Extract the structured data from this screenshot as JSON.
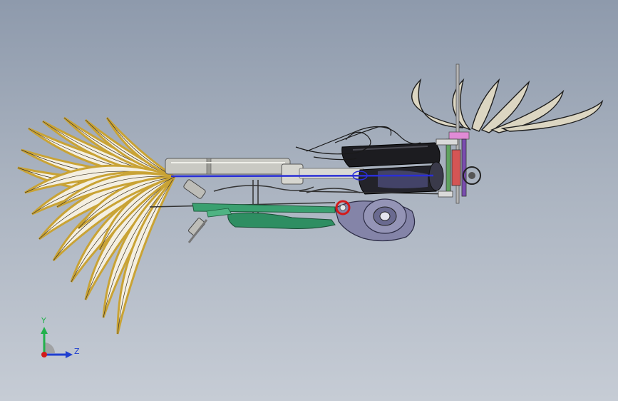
{
  "viewport": {
    "background_top": "#8e9aac",
    "background_bottom": "#c6ccd5"
  },
  "triad": {
    "y_label": "Y",
    "z_label": "Z",
    "y_color": "#22b14c",
    "z_color": "#1f3fd0",
    "x_color": "#d11a1a"
  },
  "model": {
    "description_icon": "assembly-model-icon",
    "feather_color": "#c9a335",
    "feather_fill": "#f4efe1",
    "body_black": "#1b1b1f",
    "tube_grey": "#c8c8c2",
    "rod_blue": "#2a2fd6",
    "green_part": "#2e8e62",
    "wheel_purple": "#7a7aa2",
    "marker_red": "#d41a1a"
  }
}
